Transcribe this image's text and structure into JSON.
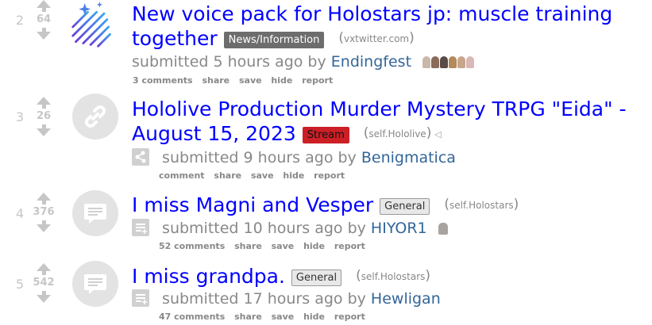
{
  "posts": [
    {
      "rank": "2",
      "score": "64",
      "title": "New voice pack for Holostars jp: muscle training together",
      "title_line1": "New voice pack for Holostars jp: muscle training",
      "title_line2": "together",
      "flair": "News/Information",
      "domain": "vxtwitter.com",
      "submitted": "submitted 5 hours ago by",
      "author": "Endingfest",
      "buttons": {
        "comments": "3 comments",
        "share": "share",
        "save": "save",
        "hide": "hide",
        "report": "report"
      },
      "thumbnail": "sparkle-lines-thumbnail"
    },
    {
      "rank": "3",
      "score": "26",
      "title": "Hololive Production Murder Mystery TRPG \"Eida\" - August 15, 2023",
      "title_line1": "Hololive Production Murder Mystery TRPG \"Eida\" -",
      "title_line2": "August 15, 2023",
      "flair": "Stream",
      "domain": "self.Hololive",
      "submitted": "submitted 9 hours ago by",
      "author": "Benigmatica",
      "buttons": {
        "comments": "comment",
        "share": "share",
        "save": "save",
        "hide": "hide",
        "report": "report"
      },
      "thumbnail": "link-icon"
    },
    {
      "rank": "4",
      "score": "376",
      "title": "I miss Magni and Vesper",
      "flair": "General",
      "domain": "self.Holostars",
      "submitted": "submitted 10 hours ago by",
      "author": "HIYOR1",
      "buttons": {
        "comments": "52 comments",
        "share": "share",
        "save": "save",
        "hide": "hide",
        "report": "report"
      },
      "thumbnail": "self-post-icon"
    },
    {
      "rank": "5",
      "score": "542",
      "title": "I miss grandpa.",
      "flair": "General",
      "domain": "self.Holostars",
      "submitted": "submitted 17 hours ago by",
      "author": "Hewligan",
      "buttons": {
        "comments": "47 comments",
        "share": "share",
        "save": "save",
        "hide": "hide",
        "report": "report"
      },
      "thumbnail": "self-post-icon"
    }
  ],
  "colors": {
    "title": "#0000ff",
    "author": "#336699",
    "muted": "#888888",
    "stream_flair": "#cc1f26",
    "news_flair": "#6d6d6d"
  }
}
